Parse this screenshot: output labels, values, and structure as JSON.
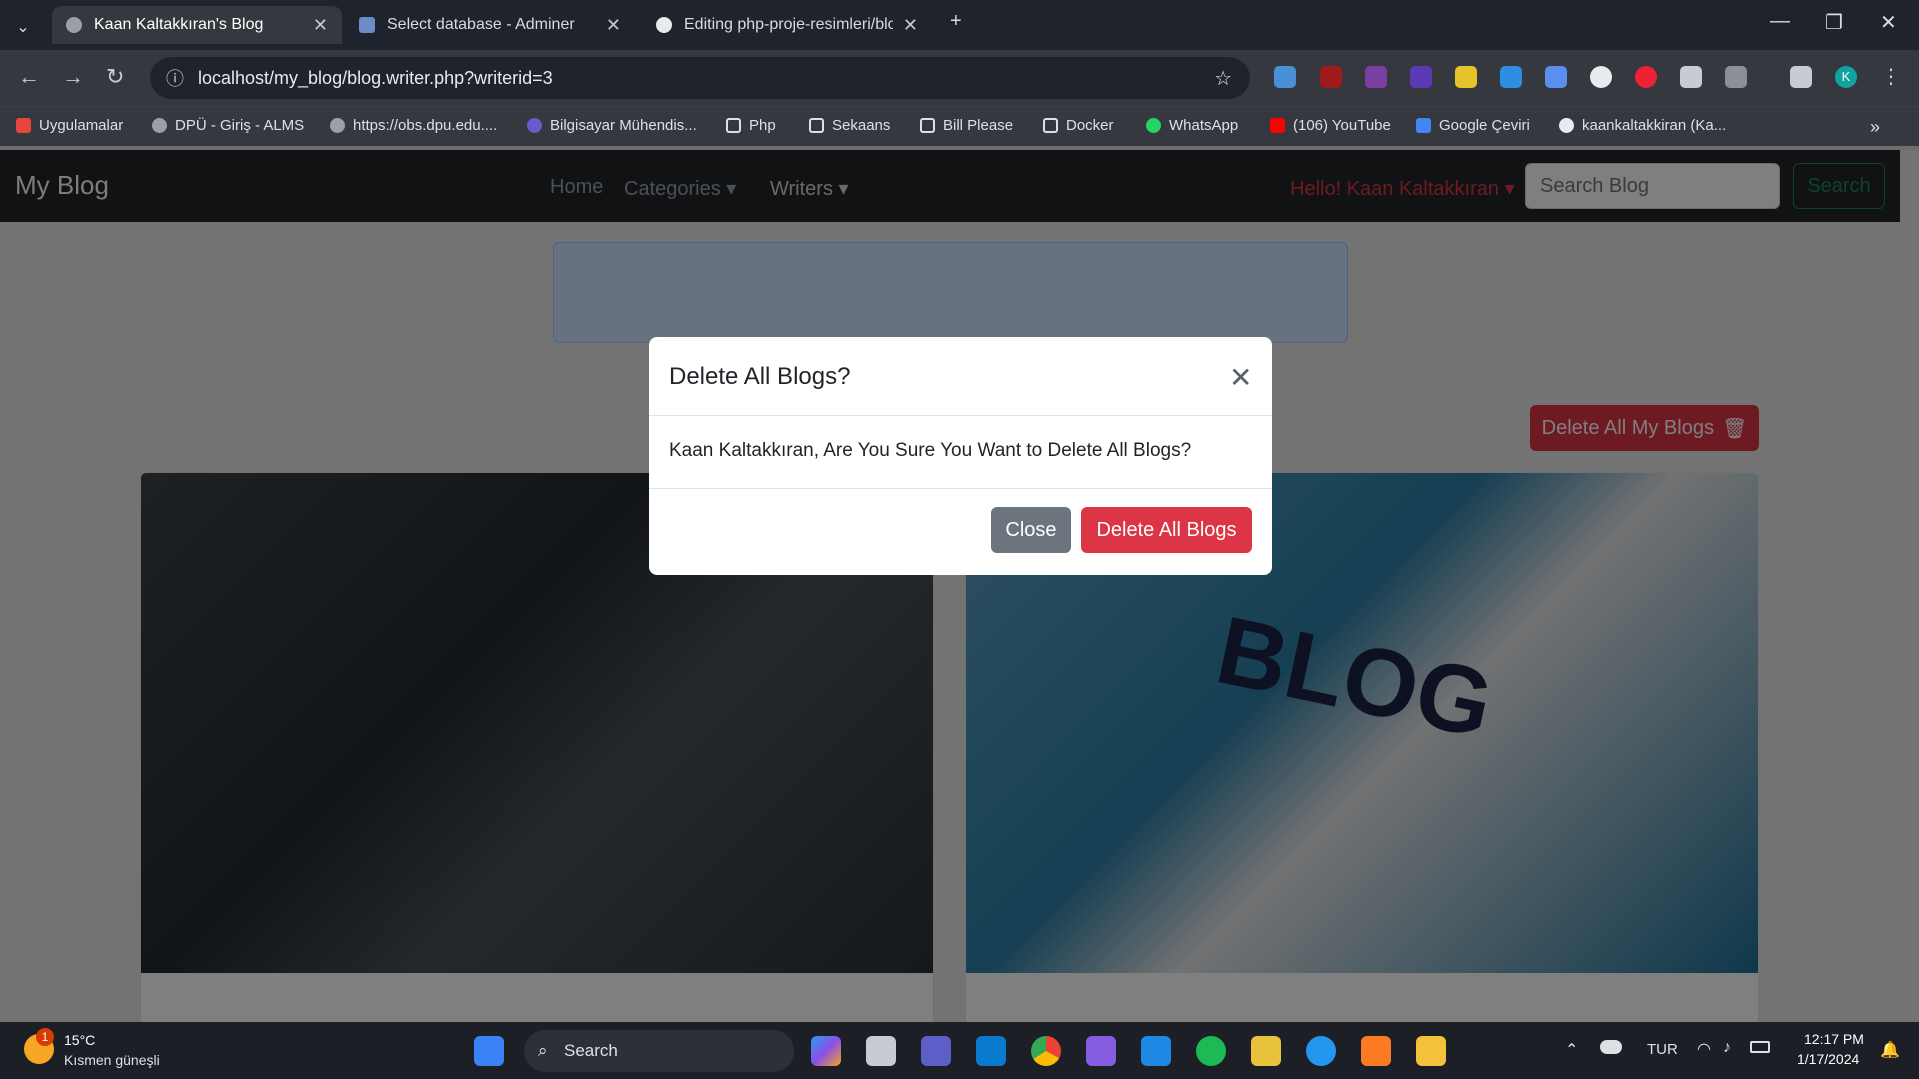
{
  "browser": {
    "tabs": [
      {
        "title": "Kaan Kaltakkıran's Blog"
      },
      {
        "title": "Select database - Adminer"
      },
      {
        "title": "Editing php-proje-resimleri/blo"
      }
    ],
    "url": "localhost/my_blog/blog.writer.php?writerid=3",
    "bookmarks": [
      "Uygulamalar",
      "DPÜ - Giriş - ALMS",
      "https://obs.dpu.edu....",
      "Bilgisayar Mühendis...",
      "Php",
      "Sekaans",
      "Bill Please",
      "Docker",
      "WhatsApp",
      "(106) YouTube",
      "Google Çeviri",
      "kaankaltakkiran (Ka..."
    ],
    "profile_initial": "K"
  },
  "site": {
    "brand": "My Blog",
    "nav": [
      "Home",
      "Categories",
      "Writers"
    ],
    "user": "Hello! Kaan Kaltakkıran",
    "search_placeholder": "Search Blog",
    "search_button": "Search",
    "delete_all_button": "Delete All My Blogs",
    "blog_image_word": "BLOG"
  },
  "modal": {
    "title": "Delete All Blogs?",
    "body": "Kaan Kaltakkıran, Are You Sure You Want to Delete All Blogs?",
    "close_label": "Close",
    "confirm_label": "Delete All Blogs"
  },
  "taskbar": {
    "weather_temp": "15°C",
    "weather_desc": "Kısmen güneşli",
    "weather_badge": "1",
    "search_label": "Search",
    "lang": "TUR",
    "time": "12:17 PM",
    "date": "1/17/2024"
  },
  "colors": {
    "accent_red": "#dc3545",
    "navbar": "#212529",
    "secondary": "#6c757d"
  }
}
